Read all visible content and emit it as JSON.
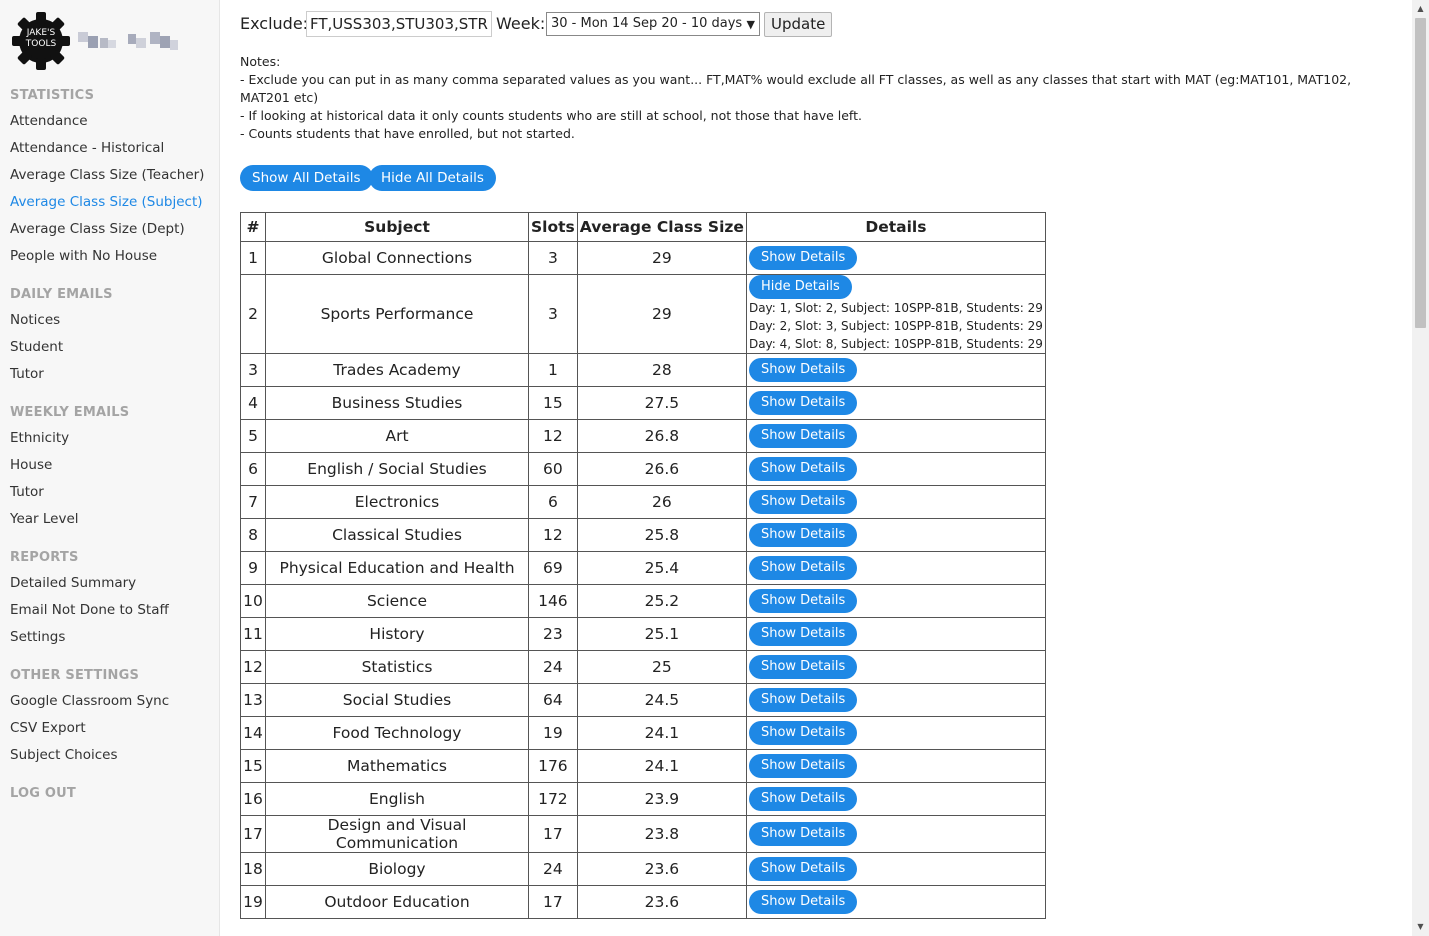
{
  "sidebar": {
    "logo_line1": "JAKE'S",
    "logo_line2": "TOOLS",
    "sections": [
      {
        "title": "STATISTICS",
        "items": [
          "Attendance",
          "Attendance - Historical",
          "Average Class Size (Teacher)",
          "Average Class Size (Subject)",
          "Average Class Size (Dept)",
          "People with No House"
        ]
      },
      {
        "title": "DAILY EMAILS",
        "items": [
          "Notices",
          "Student",
          "Tutor"
        ]
      },
      {
        "title": "WEEKLY EMAILS",
        "items": [
          "Ethnicity",
          "House",
          "Tutor",
          "Year Level"
        ]
      },
      {
        "title": "REPORTS",
        "items": [
          "Detailed Summary",
          "Email Not Done to Staff",
          "Settings"
        ]
      },
      {
        "title": "OTHER SETTINGS",
        "items": [
          "Google Classroom Sync",
          "CSV Export",
          "Subject Choices"
        ]
      },
      {
        "title": "LOG OUT",
        "items": []
      }
    ],
    "active_item": "Average Class Size (Subject)"
  },
  "filters": {
    "exclude_label": "Exclude:",
    "exclude_value": "FT,USS303,STU303,STR",
    "week_label": "Week:",
    "week_value": "30 - Mon 14 Sep 20 - 10 days",
    "update_label": "Update"
  },
  "notes": {
    "title": "Notes:",
    "lines": [
      "- Exclude you can put in as many comma separated values as you want... FT,MAT% would exclude all FT classes, as well as any classes that start with MAT (eg:MAT101, MAT102, MAT201 etc)",
      "- If looking at historical data it only counts students who are still at school, not those that have left.",
      "- Counts students that have enrolled, but not started."
    ]
  },
  "buttons": {
    "show_all": "Show All Details",
    "hide_all": "Hide All Details",
    "show_details": "Show Details",
    "hide_details": "Hide Details"
  },
  "table": {
    "headers": [
      "#",
      "Subject",
      "Slots",
      "Average Class Size",
      "Details"
    ],
    "rows": [
      {
        "n": "1",
        "subject": "Global Connections",
        "slots": "3",
        "avg": "29"
      },
      {
        "n": "2",
        "subject": "Sports Performance",
        "slots": "3",
        "avg": "29",
        "expanded": true,
        "details": [
          "Day: 1, Slot: 2, Subject: 10SPP-81B, Students: 29",
          "Day: 2, Slot: 3, Subject: 10SPP-81B, Students: 29",
          "Day: 4, Slot: 8, Subject: 10SPP-81B, Students: 29"
        ]
      },
      {
        "n": "3",
        "subject": "Trades Academy",
        "slots": "1",
        "avg": "28"
      },
      {
        "n": "4",
        "subject": "Business Studies",
        "slots": "15",
        "avg": "27.5"
      },
      {
        "n": "5",
        "subject": "Art",
        "slots": "12",
        "avg": "26.8"
      },
      {
        "n": "6",
        "subject": "English / Social Studies",
        "slots": "60",
        "avg": "26.6"
      },
      {
        "n": "7",
        "subject": "Electronics",
        "slots": "6",
        "avg": "26"
      },
      {
        "n": "8",
        "subject": "Classical Studies",
        "slots": "12",
        "avg": "25.8"
      },
      {
        "n": "9",
        "subject": "Physical Education and Health",
        "slots": "69",
        "avg": "25.4"
      },
      {
        "n": "10",
        "subject": "Science",
        "slots": "146",
        "avg": "25.2"
      },
      {
        "n": "11",
        "subject": "History",
        "slots": "23",
        "avg": "25.1"
      },
      {
        "n": "12",
        "subject": "Statistics",
        "slots": "24",
        "avg": "25"
      },
      {
        "n": "13",
        "subject": "Social Studies",
        "slots": "64",
        "avg": "24.5"
      },
      {
        "n": "14",
        "subject": "Food Technology",
        "slots": "19",
        "avg": "24.1"
      },
      {
        "n": "15",
        "subject": "Mathematics",
        "slots": "176",
        "avg": "24.1"
      },
      {
        "n": "16",
        "subject": "English",
        "slots": "172",
        "avg": "23.9"
      },
      {
        "n": "17",
        "subject": "Design and Visual Communication",
        "slots": "17",
        "avg": "23.8"
      },
      {
        "n": "18",
        "subject": "Biology",
        "slots": "24",
        "avg": "23.6"
      },
      {
        "n": "19",
        "subject": "Outdoor Education",
        "slots": "17",
        "avg": "23.6"
      }
    ]
  },
  "colors": {
    "accent": "#1e88e5",
    "section": "#a4a4a4"
  }
}
